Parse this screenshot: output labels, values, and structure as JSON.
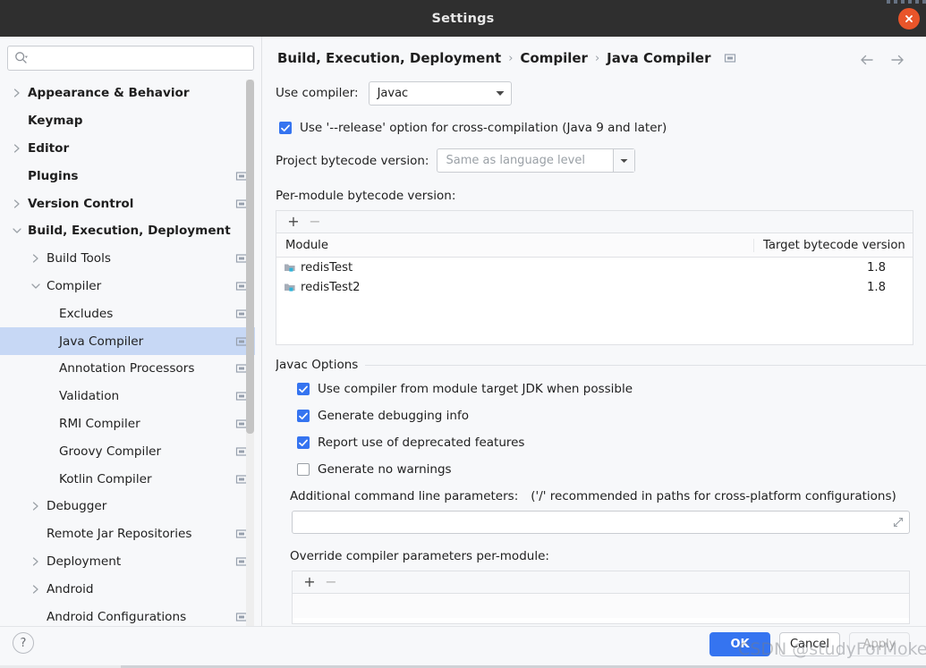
{
  "titlebar": {
    "title": "Settings",
    "close_label": "×",
    "close_icon": "close-icon"
  },
  "sidebar": {
    "search": {
      "value": "",
      "placeholder": "",
      "icon": "search-icon"
    },
    "items": [
      {
        "label": "Appearance & Behavior",
        "level": 0,
        "arrow": "right",
        "badge": false,
        "selected": false
      },
      {
        "label": "Keymap",
        "level": 0,
        "arrow": "none",
        "badge": false,
        "selected": false
      },
      {
        "label": "Editor",
        "level": 0,
        "arrow": "right",
        "badge": false,
        "selected": false
      },
      {
        "label": "Plugins",
        "level": 0,
        "arrow": "none",
        "badge": true,
        "selected": false
      },
      {
        "label": "Version Control",
        "level": 0,
        "arrow": "right",
        "badge": true,
        "selected": false
      },
      {
        "label": "Build, Execution, Deployment",
        "level": 0,
        "arrow": "down",
        "badge": false,
        "selected": false
      },
      {
        "label": "Build Tools",
        "level": 1,
        "arrow": "right",
        "badge": true,
        "selected": false
      },
      {
        "label": "Compiler",
        "level": 1,
        "arrow": "down",
        "badge": true,
        "selected": false
      },
      {
        "label": "Excludes",
        "level": 2,
        "arrow": "none",
        "badge": true,
        "selected": false
      },
      {
        "label": "Java Compiler",
        "level": 2,
        "arrow": "none",
        "badge": true,
        "selected": true
      },
      {
        "label": "Annotation Processors",
        "level": 2,
        "arrow": "none",
        "badge": true,
        "selected": false
      },
      {
        "label": "Validation",
        "level": 2,
        "arrow": "none",
        "badge": true,
        "selected": false
      },
      {
        "label": "RMI Compiler",
        "level": 2,
        "arrow": "none",
        "badge": true,
        "selected": false
      },
      {
        "label": "Groovy Compiler",
        "level": 2,
        "arrow": "none",
        "badge": true,
        "selected": false
      },
      {
        "label": "Kotlin Compiler",
        "level": 2,
        "arrow": "none",
        "badge": true,
        "selected": false
      },
      {
        "label": "Debugger",
        "level": 1,
        "arrow": "right",
        "badge": false,
        "selected": false
      },
      {
        "label": "Remote Jar Repositories",
        "level": 1,
        "arrow": "none",
        "badge": true,
        "selected": false
      },
      {
        "label": "Deployment",
        "level": 1,
        "arrow": "right",
        "badge": true,
        "selected": false
      },
      {
        "label": "Android",
        "level": 1,
        "arrow": "right",
        "badge": false,
        "selected": false
      },
      {
        "label": "Android Configurations",
        "level": 1,
        "arrow": "none",
        "badge": true,
        "selected": false
      }
    ]
  },
  "breadcrumb": {
    "items": [
      "Build, Execution, Deployment",
      "Compiler",
      "Java Compiler"
    ],
    "separator": "›",
    "badge_icon": "project-settings-icon",
    "back_icon": "arrow-left-icon",
    "forward_icon": "arrow-right-icon"
  },
  "main": {
    "use_compiler_label": "Use compiler:",
    "use_compiler_value": "Javac",
    "release_option_label": "Use '--release' option for cross-compilation (Java 9 and later)",
    "release_option_checked": true,
    "project_bytecode_label": "Project bytecode version:",
    "project_bytecode_value": "Same as language level",
    "project_bytecode_is_placeholder": true,
    "per_module_label": "Per-module bytecode version:",
    "table": {
      "add_label": "+",
      "remove_label": "−",
      "columns": [
        "Module",
        "Target bytecode version"
      ],
      "rows": [
        {
          "module": "redisTest",
          "version": "1.8"
        },
        {
          "module": "redisTest2",
          "version": "1.8"
        }
      ]
    },
    "javac_options_title": "Javac Options",
    "javac_checkboxes": [
      {
        "label": "Use compiler from module target JDK when possible",
        "checked": true
      },
      {
        "label": "Generate debugging info",
        "checked": true
      },
      {
        "label": "Report use of deprecated features",
        "checked": true
      },
      {
        "label": "Generate no warnings",
        "checked": false
      }
    ],
    "additional_params_label": "Additional command line parameters:",
    "additional_params_hint": "('/' recommended in paths for cross-platform configurations)",
    "additional_params_value": "",
    "override_label": "Override compiler parameters per-module:",
    "override_table": {
      "add_label": "+",
      "remove_label": "−"
    }
  },
  "footer": {
    "help_label": "?",
    "ok_label": "OK",
    "cancel_label": "Cancel",
    "apply_label": "Apply"
  },
  "watermark": "CSDN @studyForMokey",
  "colors": {
    "accent": "#3574f0",
    "titlebar": "#2f2f2f",
    "close": "#e9552a",
    "selection": "#c7d8f5",
    "background": "#f7f8fa"
  }
}
